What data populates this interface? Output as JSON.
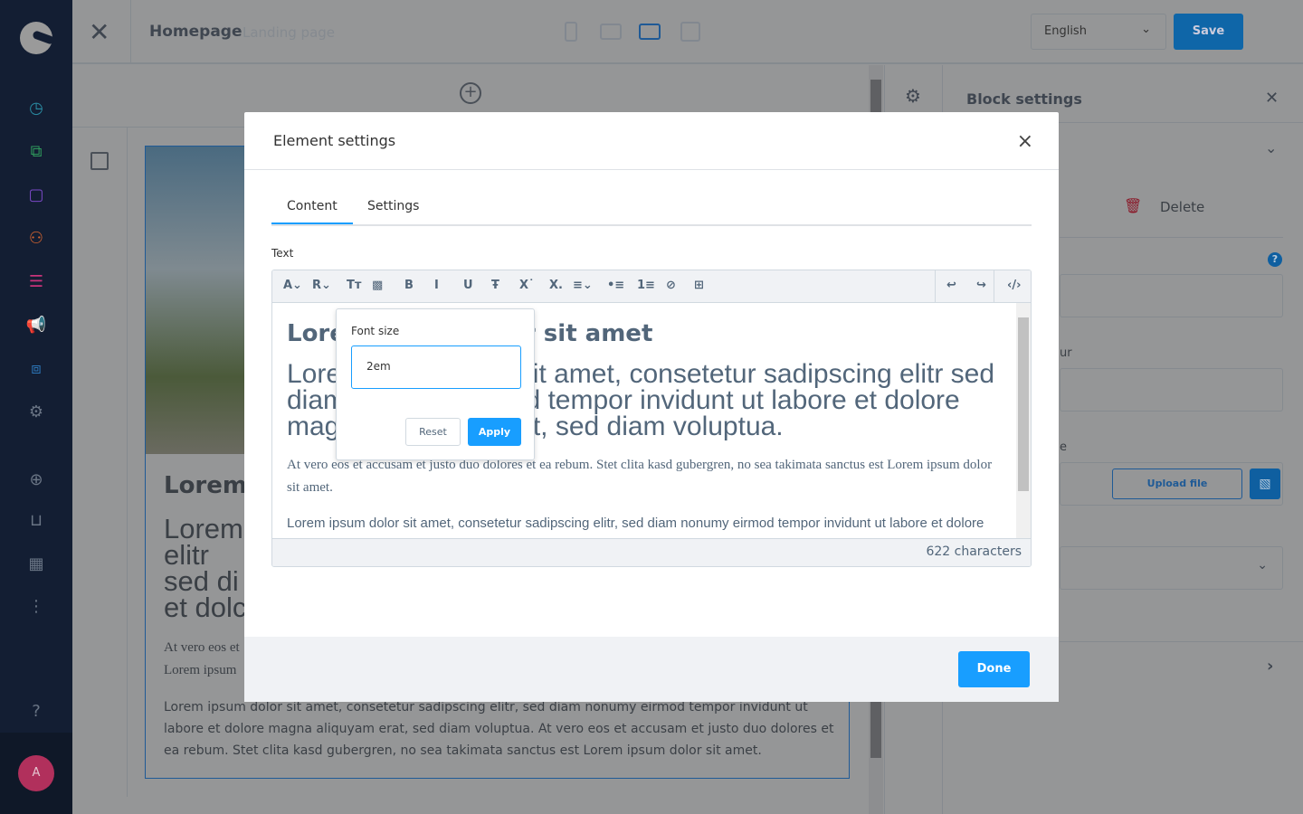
{
  "sidebar": {
    "items": [
      {
        "icon": "dashboard-icon",
        "glyph": "◷",
        "color": "#2a8ca3"
      },
      {
        "icon": "catalog-icon",
        "glyph": "⧉",
        "color": "#2f9a5c"
      },
      {
        "icon": "orders-icon",
        "glyph": "▢",
        "color": "#7a48c6"
      },
      {
        "icon": "customers-icon",
        "glyph": "⚇",
        "color": "#d8652f"
      },
      {
        "icon": "content-icon",
        "glyph": "☰",
        "color": "#c8337a"
      },
      {
        "icon": "marketing-icon",
        "glyph": "📢",
        "color": "#c9a21b"
      },
      {
        "icon": "extensions-icon",
        "glyph": "⧈",
        "color": "#2c76b8"
      },
      {
        "icon": "settings-icon",
        "glyph": "⚙",
        "color": "#6a7585"
      },
      {
        "icon": "add-icon",
        "glyph": "⊕",
        "color": "#6a7585"
      },
      {
        "icon": "basket-icon",
        "glyph": "⊔",
        "color": "#6a7585"
      },
      {
        "icon": "store-icon",
        "glyph": "▦",
        "color": "#6a7585"
      },
      {
        "icon": "more-icon",
        "glyph": "⋮",
        "color": "#6a7585"
      },
      {
        "icon": "help-icon",
        "glyph": "?",
        "color": "#6a7585"
      }
    ],
    "avatar": "A"
  },
  "header": {
    "title": "Homepage",
    "subtitle": "Landing page",
    "language": "English",
    "save_label": "Save"
  },
  "background_page": {
    "heading": "Lorem",
    "big": "Lorem\nelitr\nsed di\net dolc",
    "serif": "At vero eos et",
    "serif2": "Lorem ipsum",
    "para": "Lorem ipsum dolor sit amet, consetetur sadipscing elitr, sed diam nonumy eirmod tempor invidunt ut labore et dolore magna aliquyam erat, sed diam voluptua. At vero eos et accusam et justo duo dolores et ea rebum. Stet clita kasd gubergren, no sea takimata sanctus est Lorem ipsum dolor sit amet."
  },
  "block_settings": {
    "title": "Block settings",
    "delete_label": "Delete",
    "label_fragment_1": "ur",
    "label_fragment_2": "e",
    "upload_label": "Upload file"
  },
  "modal": {
    "title": "Element settings",
    "tabs": [
      {
        "label": "Content",
        "active": true
      },
      {
        "label": "Settings",
        "active": false
      }
    ],
    "text_label": "Text",
    "toolbar": [
      "font-family-icon",
      "font-format-icon",
      "font-size-icon",
      "color-icon",
      "bold-icon",
      "italic-icon",
      "underline-icon",
      "strikethrough-icon",
      "superscript-icon",
      "subscript-icon",
      "align-icon",
      "bullet-list-icon",
      "numbered-list-icon",
      "link-icon",
      "table-icon",
      "undo-icon",
      "redo-icon",
      "code-view-icon"
    ],
    "content": {
      "heading": "Lorem ipsum dolor sit amet",
      "big": "Lorem ipsum dolor sit amet, consetetur sadipscing elitr sed diam nonumy eirmod tempor invidunt ut labore et dolore magna aliquyam erat, sed diam voluptua.",
      "serif": "At vero eos et accusam et justo duo dolores et ea rebum. Stet clita kasd gubergren, no sea takimata sanctus est Lorem ipsum dolor sit amet.",
      "para": "Lorem ipsum dolor sit amet, consetetur sadipscing elitr, sed diam nonumy eirmod tempor invidunt ut labore et dolore"
    },
    "char_count": "622 characters",
    "popover": {
      "label": "Font size",
      "value": "2em",
      "reset_label": "Reset",
      "apply_label": "Apply"
    },
    "done_label": "Done"
  },
  "colors": {
    "accent": "#189eff",
    "sidebar": "#131e33"
  }
}
